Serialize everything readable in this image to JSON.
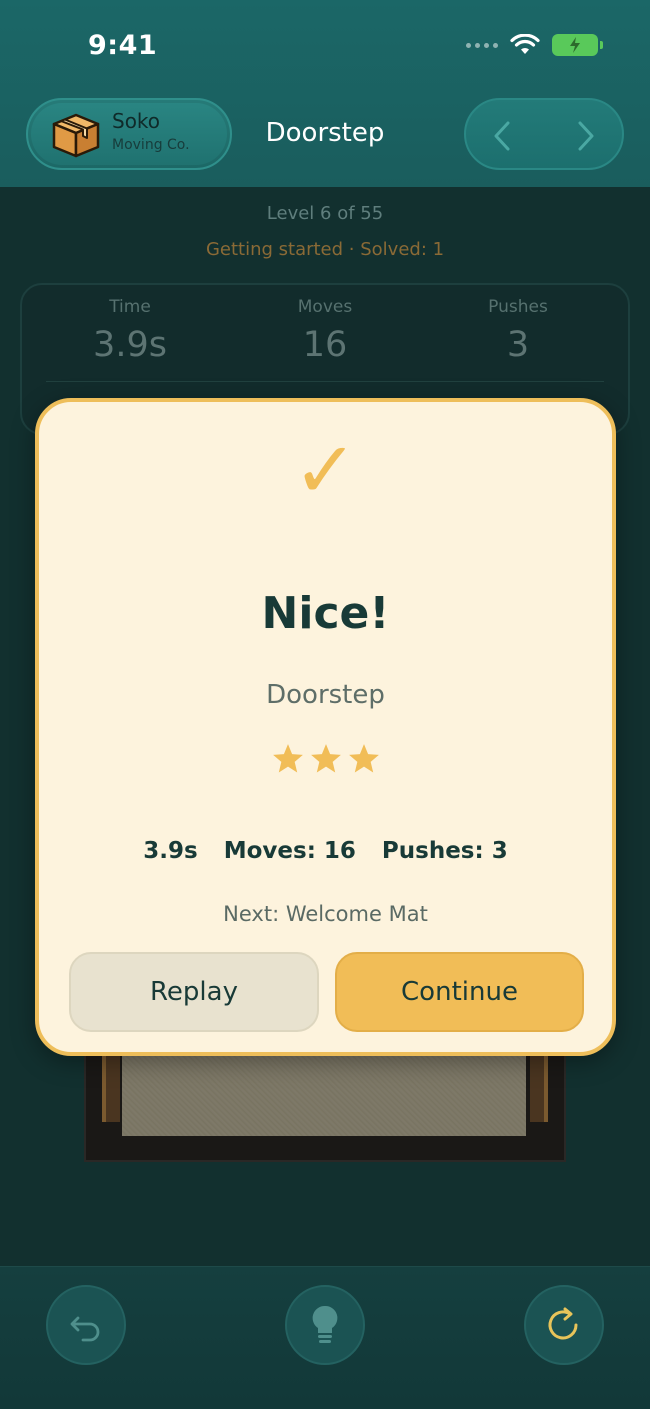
{
  "status_bar": {
    "time": "9:41"
  },
  "header": {
    "brand_name": "Soko",
    "brand_sub": "Moving Co.",
    "title": "Doorstep"
  },
  "level": {
    "progress": "Level 6 of 55",
    "section": "Getting started · Solved: 1"
  },
  "stats": [
    {
      "label": "Time",
      "value": "3.9s"
    },
    {
      "label": "Moves",
      "value": "16"
    },
    {
      "label": "Pushes",
      "value": "3"
    }
  ],
  "modal": {
    "check": "✓",
    "title": "Nice!",
    "level_name": "Doorstep",
    "stars_earned": 3,
    "stars_total": 3,
    "time": "3.9s",
    "moves": "Moves: 16",
    "pushes": "Pushes: 3",
    "next": "Next: Welcome Mat",
    "replay_label": "Replay",
    "continue_label": "Continue"
  },
  "colors": {
    "accent": "#f1bd57",
    "header_bg": "#1b6767",
    "modal_bg": "#fdf3dd",
    "text_dark": "#183a37"
  },
  "icons": [
    "box-logo-icon",
    "chevron-left-icon",
    "chevron-right-icon",
    "undo-icon",
    "lightbulb-icon",
    "restart-icon",
    "star-icon",
    "checkmark-icon",
    "wifi-icon",
    "battery-charging-icon",
    "signal-icon"
  ]
}
